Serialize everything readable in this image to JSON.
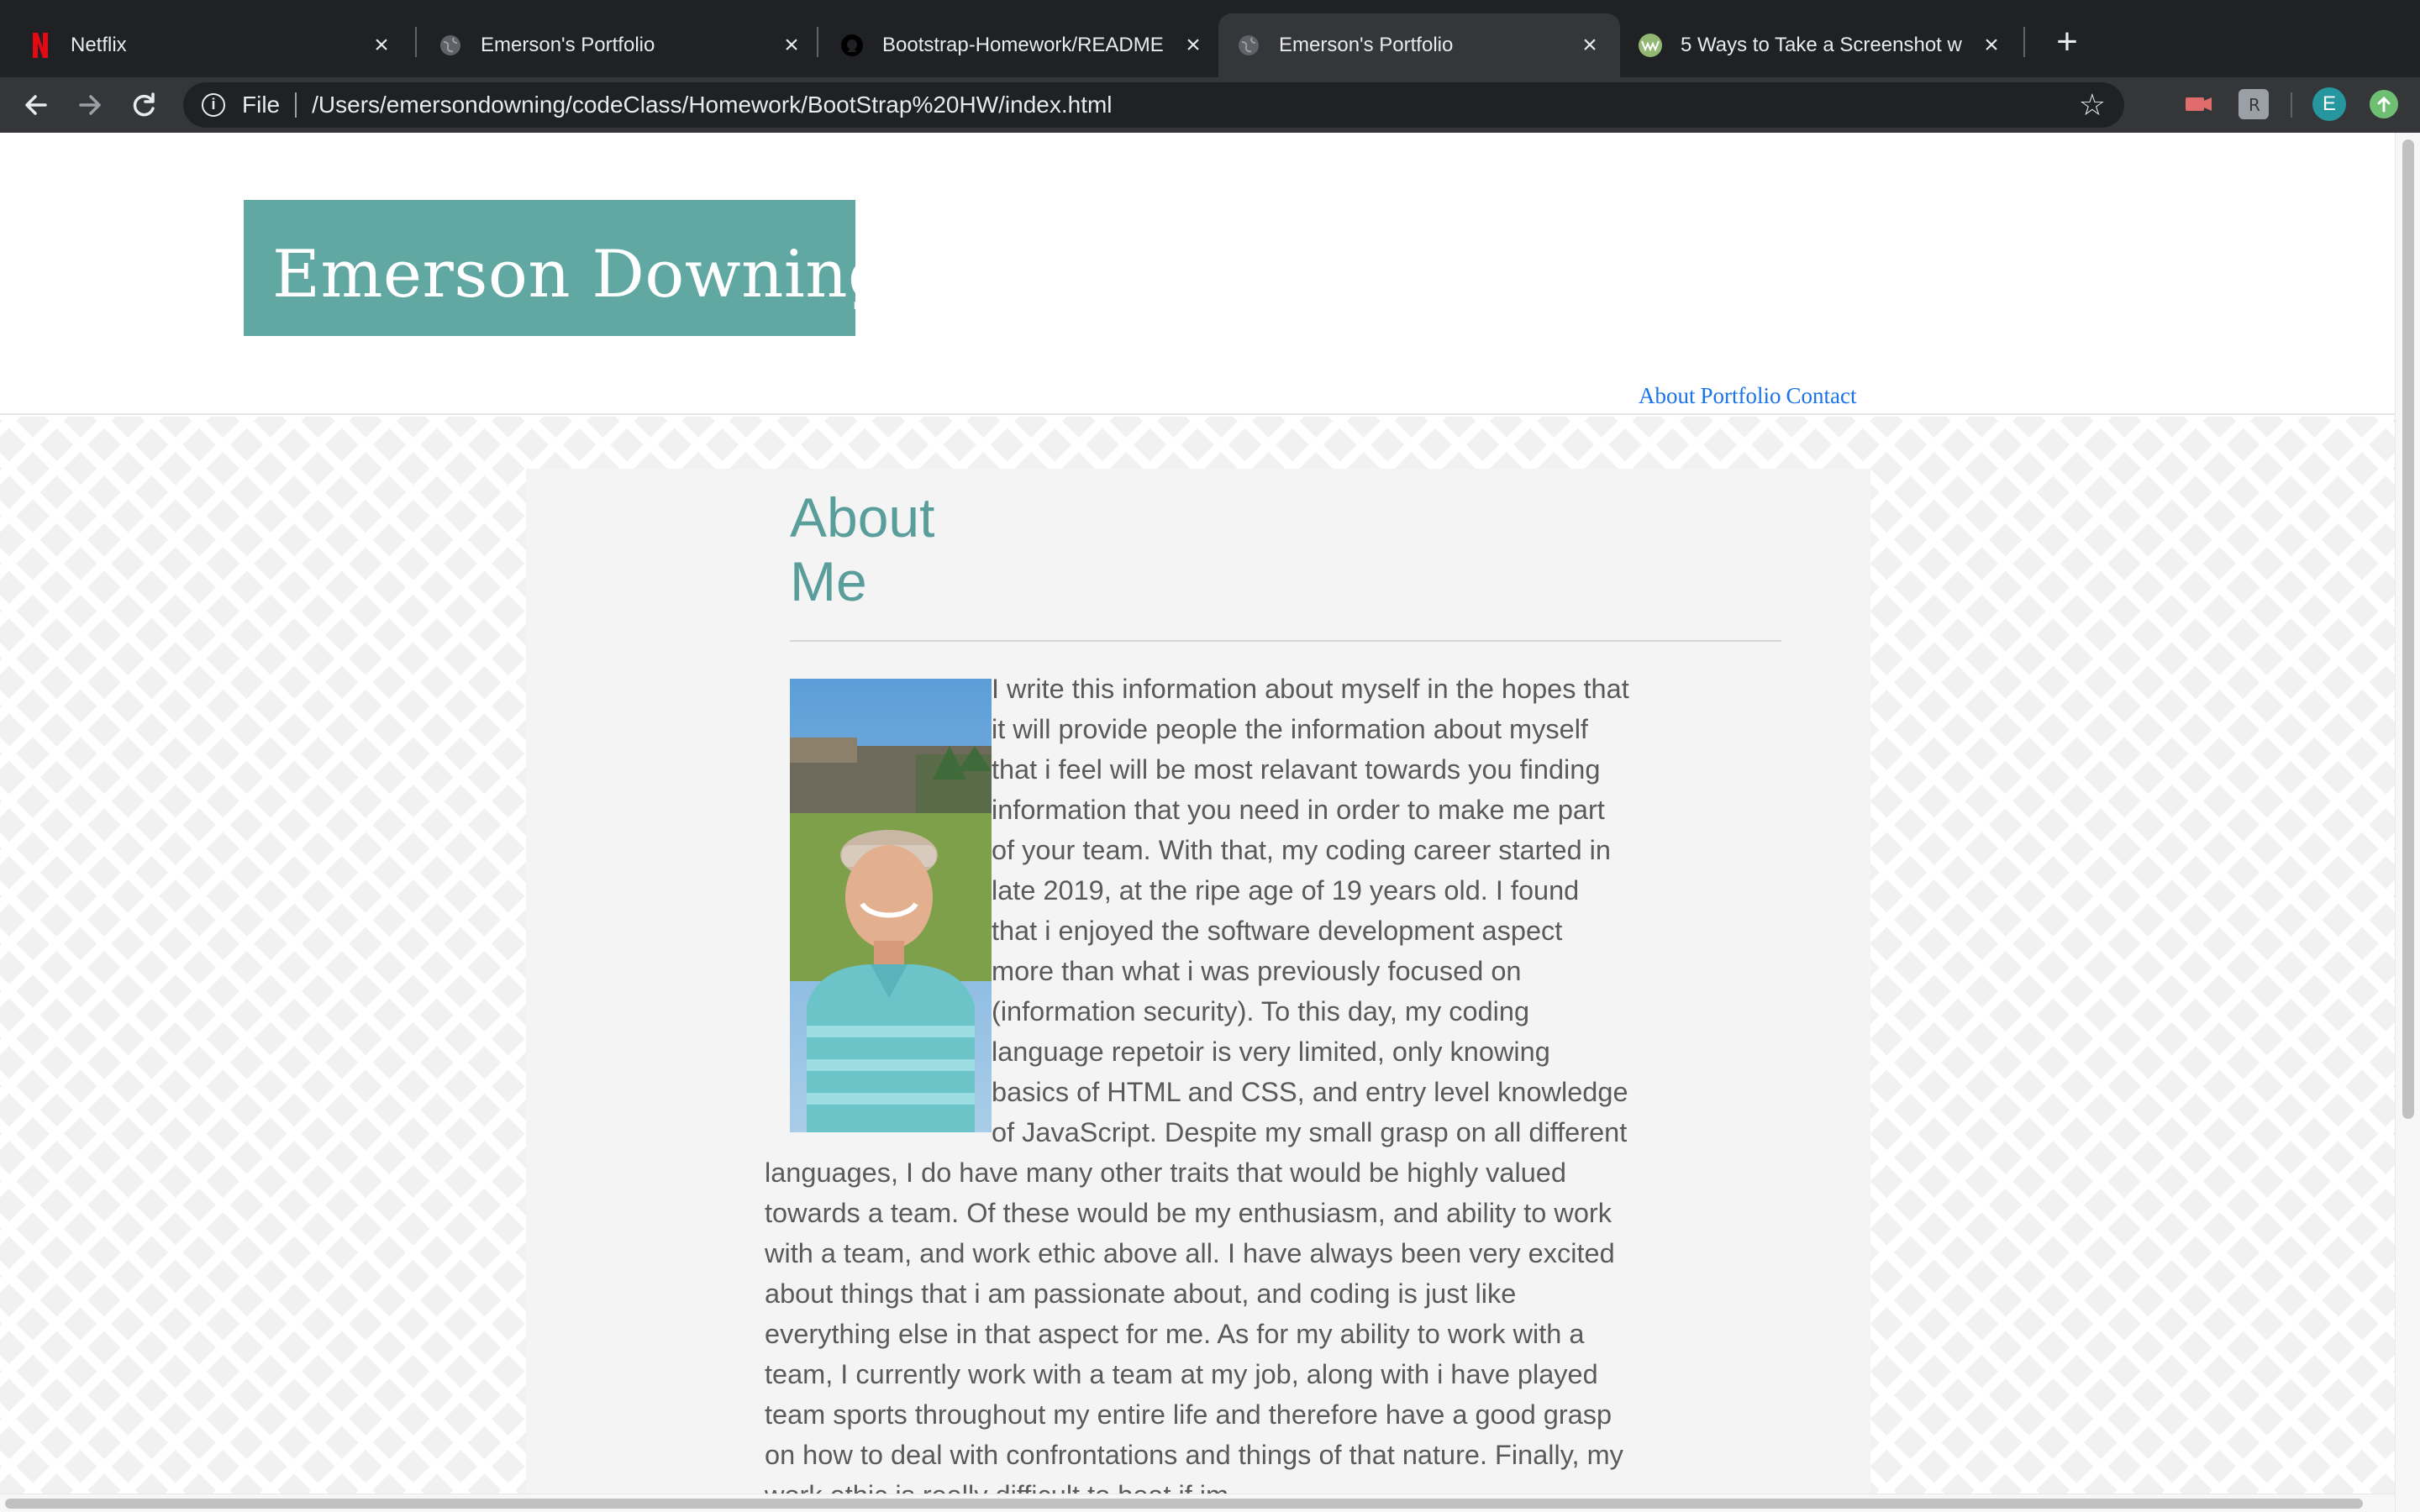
{
  "browser": {
    "tabs": [
      {
        "title": "Netflix",
        "active": false,
        "favicon": "netflix-icon"
      },
      {
        "title": "Emerson's Portfolio",
        "active": false,
        "favicon": "globe-icon"
      },
      {
        "title": "Bootstrap-Homework/README",
        "active": false,
        "favicon": "github-icon"
      },
      {
        "title": "Emerson's Portfolio",
        "active": true,
        "favicon": "globe-icon"
      },
      {
        "title": "5 Ways to Take a Screenshot w",
        "active": false,
        "favicon": "wikihow-icon"
      }
    ],
    "new_tab": "+",
    "omnibox": {
      "scheme_label": "File",
      "url": "/Users/emersondowning/codeClass/Homework/BootStrap%20HW/index.html"
    },
    "profile_initial": "E",
    "colors": {
      "frame": "#202124",
      "toolbar": "#35363a",
      "text": "#e8eaed"
    }
  },
  "site": {
    "logo_text": "Emerson Downing",
    "nav": [
      "About",
      "Portfolio",
      "Contact"
    ],
    "colors": {
      "brand": "#61a8a3",
      "heading": "#5a9e9b",
      "link": "#1a73e8",
      "body_text": "#5a5a5a"
    }
  },
  "about": {
    "heading_line1": "About",
    "heading_line2": "Me",
    "body": "I write this information about myself in the hopes that it will provide people the information about myself that i feel will be most relavant towards you finding information that you need in order to make me part of your team. With that, my coding career started in late 2019, at the ripe age of 19 years old. I found that i enjoyed the software development aspect more than what i was previously focused on (information security). To this day, my coding language repetoir is very limited, only knowing basics of HTML and CSS, and entry level knowledge of JavaScript. Despite my small grasp on all different languages, I do have many other traits that would be highly valued towards a team. Of these would be my enthusiasm, and ability to work with a team, and work ethic above all. I have always been very excited about things that i am passionate about, and coding is just like everything else in that aspect for me. As for my ability to work with a team, I currently work with a team at my job, along with i have played team sports throughout my entire life and therefore have a good grasp on how to deal with confrontations and things of that nature. Finally, my work ethic is really difficult to beat if im"
  }
}
